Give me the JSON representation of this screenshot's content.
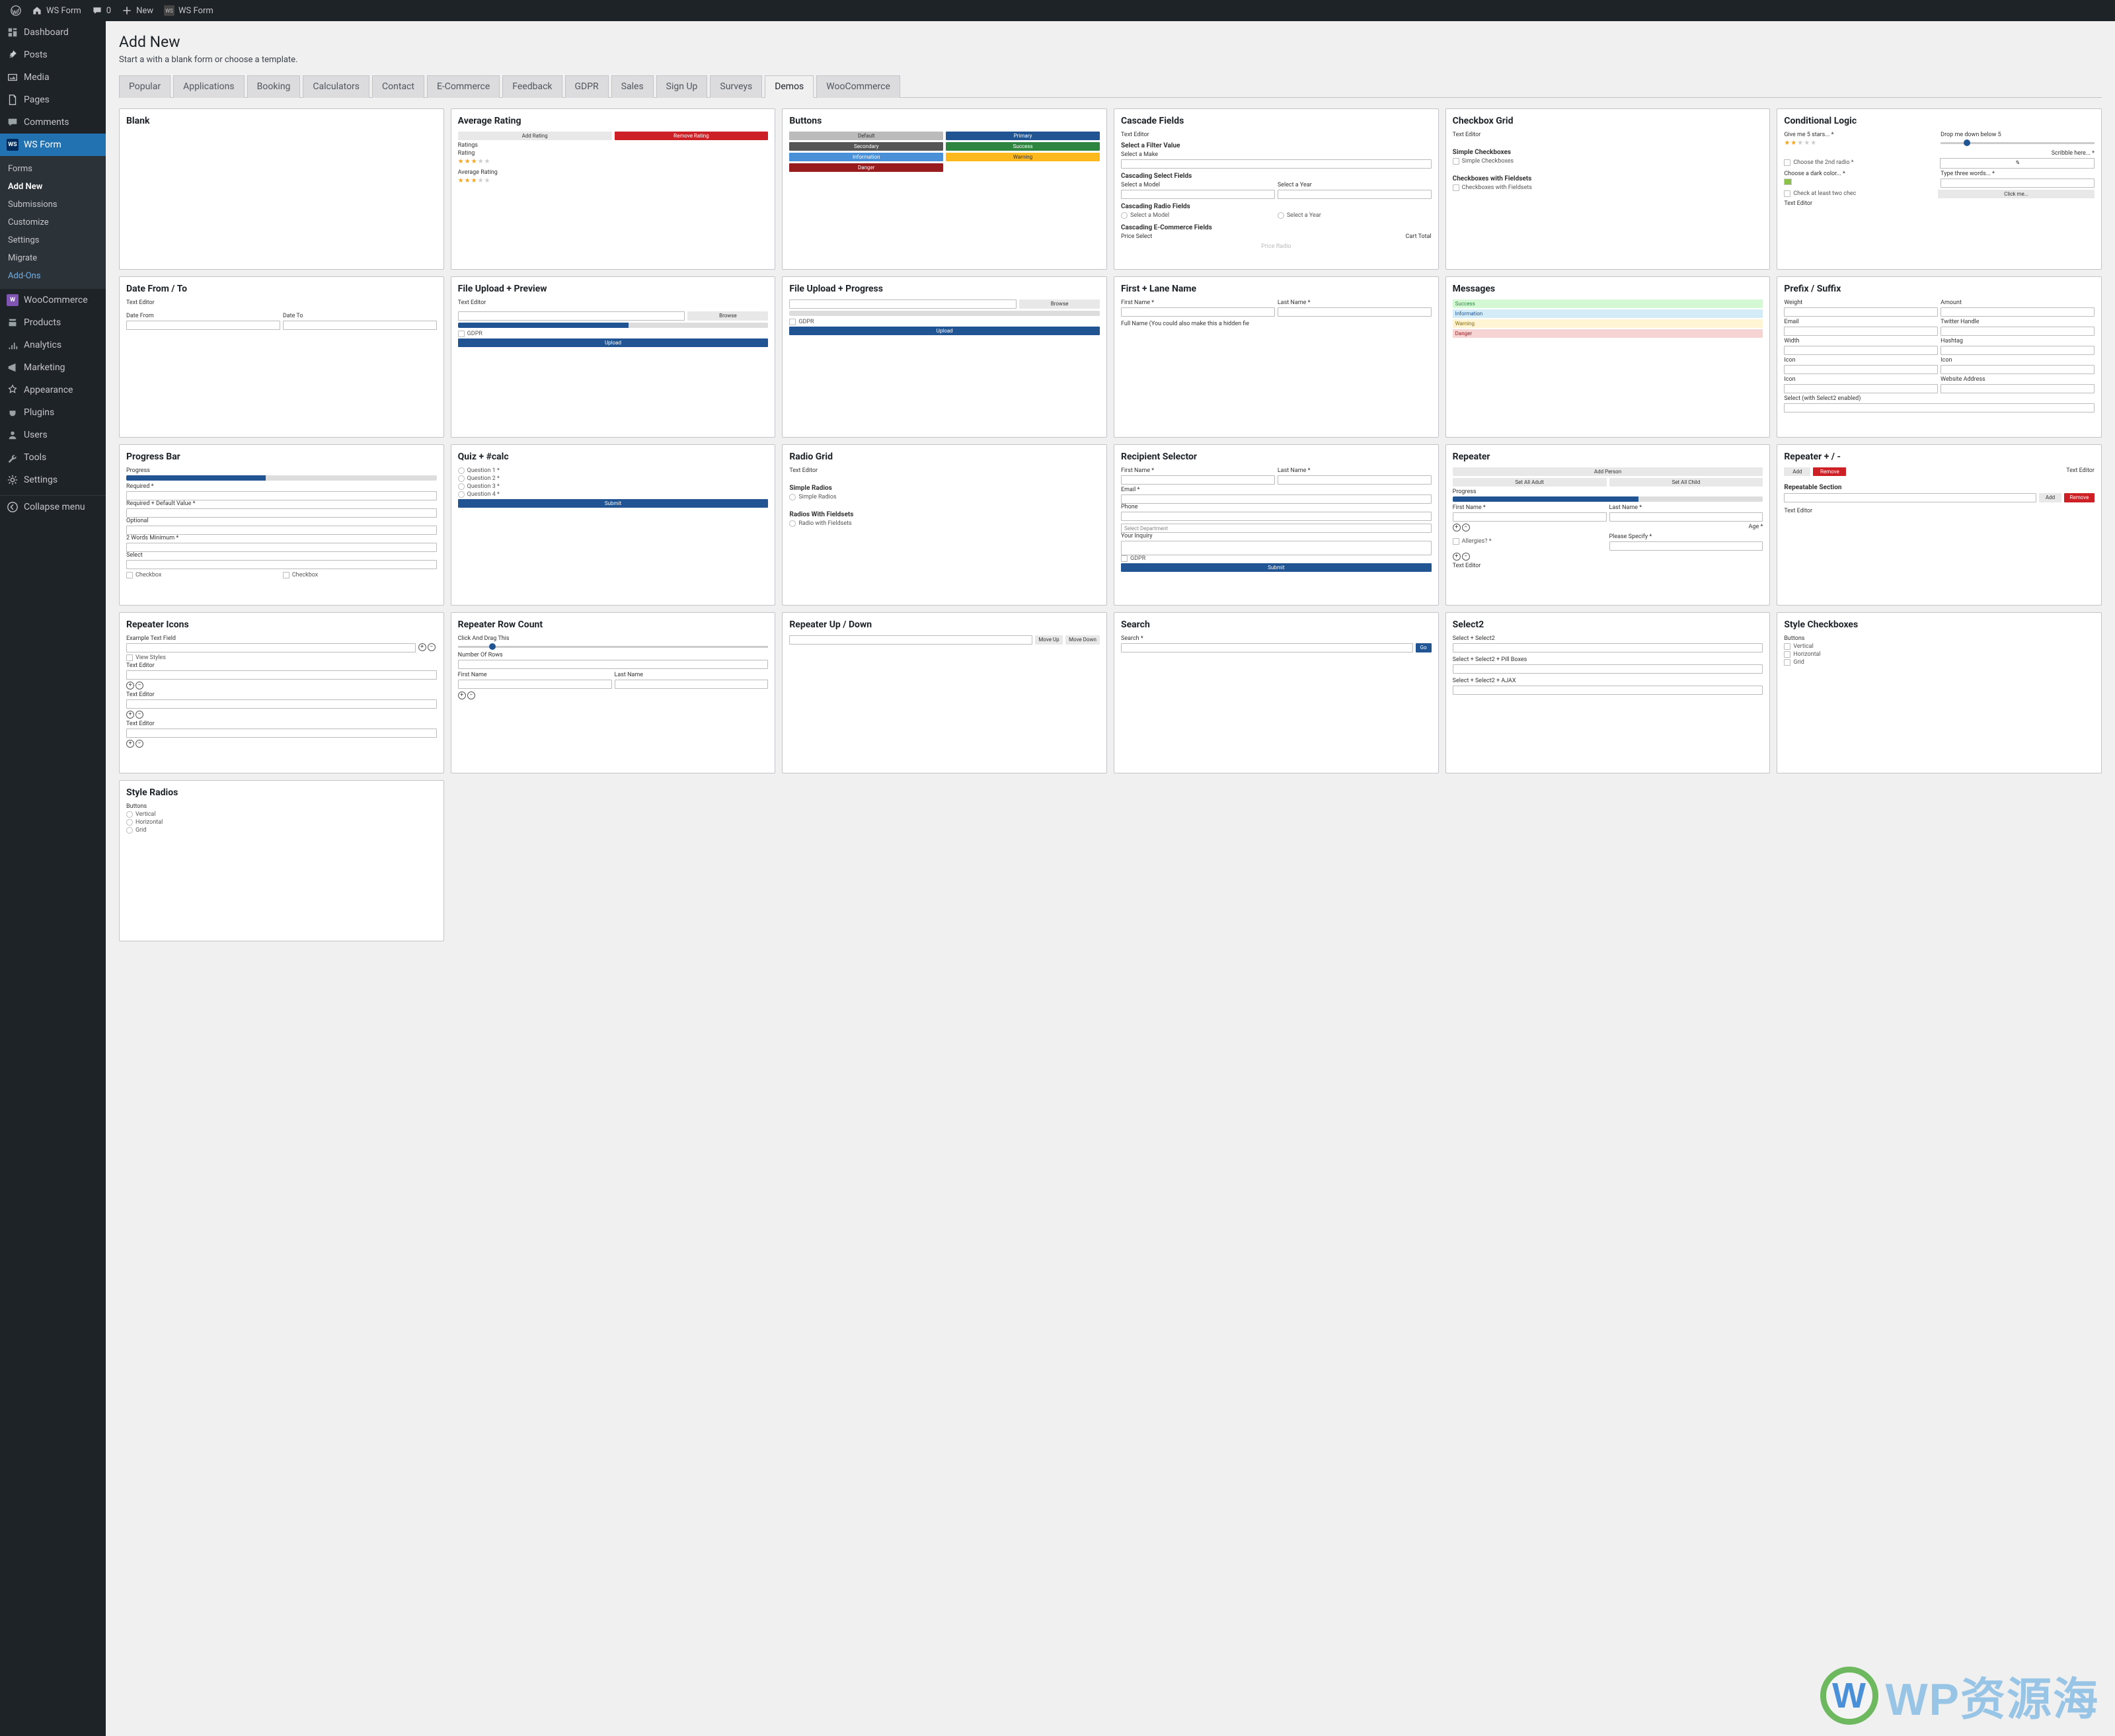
{
  "adminbar": {
    "site_name": "WS Form",
    "comments_count": "0",
    "new_label": "New",
    "app_label": "WS Form"
  },
  "sidebar": {
    "items": [
      {
        "icon": "dashboard",
        "label": "Dashboard"
      },
      {
        "icon": "pin",
        "label": "Posts"
      },
      {
        "icon": "media",
        "label": "Media"
      },
      {
        "icon": "page",
        "label": "Pages"
      },
      {
        "icon": "comment",
        "label": "Comments"
      },
      {
        "icon": "wsform",
        "label": "WS Form",
        "current": true
      },
      {
        "icon": "woo",
        "label": "WooCommerce"
      },
      {
        "icon": "product",
        "label": "Products"
      },
      {
        "icon": "analytics",
        "label": "Analytics"
      },
      {
        "icon": "marketing",
        "label": "Marketing"
      },
      {
        "icon": "appearance",
        "label": "Appearance"
      },
      {
        "icon": "plugin",
        "label": "Plugins"
      },
      {
        "icon": "users",
        "label": "Users"
      },
      {
        "icon": "tools",
        "label": "Tools"
      },
      {
        "icon": "settings",
        "label": "Settings"
      }
    ],
    "submenu": [
      "Forms",
      "Add New",
      "Submissions",
      "Customize",
      "Settings",
      "Migrate",
      "Add-Ons"
    ],
    "submenu_current": "Add New",
    "submenu_accent": "Add-Ons",
    "collapse_label": "Collapse menu"
  },
  "page": {
    "title": "Add New",
    "subtitle": "Start a with a blank form or choose a template."
  },
  "tabs": [
    "Popular",
    "Applications",
    "Booking",
    "Calculators",
    "Contact",
    "E-Commerce",
    "Feedback",
    "GDPR",
    "Sales",
    "Sign Up",
    "Surveys",
    "Demos",
    "WooCommerce"
  ],
  "tab_active": "Demos",
  "cards": {
    "blank": {
      "title": "Blank"
    },
    "avg_rating": {
      "title": "Average Rating",
      "add": "Add Rating",
      "remove": "Remove Rating",
      "ratings": "Ratings",
      "rating": "Rating",
      "avg": "Average Rating"
    },
    "buttons": {
      "title": "Buttons",
      "default": "Default",
      "primary": "Primary",
      "secondary": "Secondary",
      "success": "Success",
      "information": "Information",
      "warning": "Warning",
      "danger": "Danger"
    },
    "cascade": {
      "title": "Cascade Fields",
      "text_editor": "Text Editor",
      "filter": "Select a Filter Value",
      "make": "Select a Make",
      "select": "Cascading Select Fields",
      "model": "Select a Model",
      "year": "Select a Year",
      "radio": "Cascading Radio Fields",
      "r_model": "Select a Model",
      "r_year": "Select a Year",
      "ecom": "Cascading E-Commerce Fields",
      "price_select": "Price Select",
      "cart_total": "Cart Total",
      "price_radio": "Price Radio"
    },
    "checkbox_grid": {
      "title": "Checkbox Grid",
      "text_editor": "Text Editor",
      "simple": "Simple Checkboxes",
      "simple_item": "Simple Checkboxes",
      "fieldsets": "Checkboxes with Fieldsets",
      "fieldset_item": "Checkboxes with Fieldsets"
    },
    "conditional": {
      "title": "Conditional Logic",
      "give5": "Give me 5 stars... *",
      "drop": "Drop me down below 5",
      "scribble": "Scribble here... *",
      "choose2": "Choose the 2nd radio *",
      "darkcolor": "Choose a dark color... *",
      "type3": "Type three words... *",
      "check2": "Check at least two chec",
      "clickme": "Click me...",
      "text_editor": "Text Editor"
    },
    "date": {
      "title": "Date From / To",
      "text_editor": "Text Editor",
      "from": "Date From",
      "to": "Date To"
    },
    "fup_preview": {
      "title": "File Upload + Preview",
      "text_editor": "Text Editor",
      "browse": "Browse",
      "gdpr": "GDPR",
      "upload": "Upload"
    },
    "fup_progress": {
      "title": "File Upload + Progress",
      "browse": "Browse",
      "gdpr": "GDPR",
      "upload": "Upload"
    },
    "firstlane": {
      "title": "First + Lane Name",
      "first": "First Name *",
      "last": "Last Name *",
      "full": "Full Name (You could also make this a hidden fie"
    },
    "messages": {
      "title": "Messages",
      "success": "Success",
      "info": "Information",
      "warn": "Warning",
      "danger": "Danger"
    },
    "prefix": {
      "title": "Prefix / Suffix",
      "weight": "Weight",
      "amount": "Amount",
      "email": "Email",
      "twitter": "Twitter Handle",
      "width": "Width",
      "hashtag": "Hashtag",
      "icon": "Icon",
      "website": "Website Address",
      "select2": "Select (with Select2 enabled)"
    },
    "progressbar": {
      "title": "Progress Bar",
      "progress": "Progress",
      "required": "Required *",
      "reqdef": "Required + Default Value *",
      "optional": "Optional",
      "twowords": "2 Words Minimum *",
      "select": "Select",
      "checkbox": "Checkbox"
    },
    "quiz": {
      "title": "Quiz + #calc",
      "q1": "Question 1 *",
      "q2": "Question 2 *",
      "q3": "Question 3 *",
      "q4": "Question 4 *",
      "submit": "Submit"
    },
    "radiogrid": {
      "title": "Radio Grid",
      "text_editor": "Text Editor",
      "simple": "Simple Radios",
      "simple_item": "Simple Radios",
      "fieldsets": "Radios With Fieldsets",
      "fieldset_item": "Radio with Fieldsets"
    },
    "recipient": {
      "title": "Recipient Selector",
      "first": "First Name *",
      "last": "Last Name *",
      "email": "Email *",
      "phone": "Phone",
      "dept": "Select Department",
      "inquiry": "Your Inquiry",
      "gdpr": "GDPR",
      "submit": "Submit"
    },
    "repeater": {
      "title": "Repeater",
      "add_person": "Add Person",
      "set_adult": "Set All Adult",
      "set_child": "Set All Child",
      "progress": "Progress",
      "first": "First Name *",
      "last": "Last Name *",
      "allergies": "Allergies? *",
      "age": "Age *",
      "please": "Please Specify *",
      "text_editor": "Text Editor"
    },
    "repeater_pm": {
      "title": "Repeater + / -",
      "add": "Add",
      "remove": "Remove",
      "text_editor": "Text Editor",
      "section": "Repeatable Section"
    },
    "repeater_icons": {
      "title": "Repeater Icons",
      "example": "Example Text Field",
      "view": "View Styles",
      "text_editor": "Text Editor"
    },
    "repeater_row": {
      "title": "Repeater Row Count",
      "click": "Click And Drag This",
      "rows": "Number Of Rows",
      "first": "First Name",
      "last": "Last Name"
    },
    "repeater_ud": {
      "title": "Repeater Up / Down",
      "up": "Move Up",
      "down": "Move Down"
    },
    "search": {
      "title": "Search",
      "label": "Search *",
      "go": "Go"
    },
    "select2": {
      "title": "Select2",
      "a": "Select + Select2",
      "b": "Select + Select2 + Pill Boxes",
      "c": "Select + Select2 + AJAX"
    },
    "style_cb": {
      "title": "Style Checkboxes",
      "buttons": "Buttons",
      "v": "Vertical",
      "h": "Horizontal",
      "g": "Grid"
    },
    "style_radio": {
      "title": "Style Radios",
      "buttons": "Buttons",
      "v": "Vertical",
      "h": "Horizontal",
      "g": "Grid"
    }
  },
  "watermark": {
    "text": "WP资源海"
  }
}
